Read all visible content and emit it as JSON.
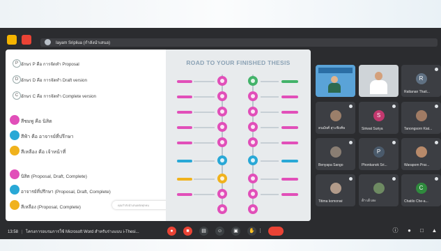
{
  "topbar": {
    "presenter_label": "Iayam Sripliua (กำลังนำเสนอ)"
  },
  "slide": {
    "rows_top": [
      {
        "badge": "P",
        "text": "อักษร P คือ การจัดทำ Proposal"
      },
      {
        "badge": "D",
        "text": "อักษร D คือ การจัดทำ Draft version"
      },
      {
        "badge": "C",
        "text": "อักษร C คือ การจัดทำ Complete version"
      }
    ],
    "rows_middle": [
      {
        "color": "#e14fb9",
        "text": "สีชมพู คือ นิสิต"
      },
      {
        "color": "#29a8d6",
        "text": "สีฟ้า คือ อาจารย์ที่ปรึกษา"
      },
      {
        "color": "#f0b21d",
        "text": "สีเหลือง คือ เจ้าหน้าที่"
      }
    ],
    "rows_bottom": [
      {
        "color": "#e14fb9",
        "text": "นิสิต (Proposal, Draft, Complete)"
      },
      {
        "color": "#29a8d6",
        "text": "อาจารย์ที่ปรึกษา (Proposal, Draft, Complete)"
      },
      {
        "color": "#f0b21d",
        "text": "สีเหลือง (Proposal, Complete)"
      }
    ],
    "banner": {
      "text": "คุณกำลังนำเสนอต่อทุกคน",
      "button": "Stop sharing"
    },
    "infographic_title": "ROAD TO YOUR FINISHED THESIS",
    "colors": {
      "pink": "#e14fb9",
      "blue": "#29a8d6",
      "yellow": "#f0b21d",
      "green": "#43b36a"
    }
  },
  "participants": [
    {
      "name": "",
      "kind": "video",
      "bg": "#5aa3d8"
    },
    {
      "name": "",
      "kind": "video",
      "bg": "#cfd4d8"
    },
    {
      "name": "Rattanan Thait...",
      "kind": "avatar",
      "initial": "R",
      "color": "#5f7082"
    },
    {
      "name": "ดนมัยศ์ สุวะพิงศ์ษ",
      "kind": "photo",
      "initial": "",
      "color": "#9b7f6a"
    },
    {
      "name": "Siriwat Suriya",
      "kind": "avatar",
      "initial": "S",
      "color": "#c2386e"
    },
    {
      "name": "Tanongsorn Kiat...",
      "kind": "photo",
      "initial": "",
      "color": "#a07b64"
    },
    {
      "name": "Benyapa Sango",
      "kind": "photo",
      "initial": "",
      "color": "#8a7e73"
    },
    {
      "name": "Phonkanok Sri...",
      "kind": "avatar",
      "initial": "P",
      "color": "#4a5a6b"
    },
    {
      "name": "Warapom Prar...",
      "kind": "photo",
      "initial": "",
      "color": "#b88a6a"
    },
    {
      "name": "Titima komonwi",
      "kind": "photo",
      "initial": "",
      "color": "#b29b8a"
    },
    {
      "name": "อ้า เอ้ เอะ",
      "kind": "photo",
      "initial": "",
      "color": "#6e8a62"
    },
    {
      "name": "Chatilo Che-a...",
      "kind": "avatar",
      "initial": "C",
      "color": "#2f8a3d"
    }
  ],
  "bottombar": {
    "time": "13:58",
    "meeting_title": "โครงการอบรมการใช้ Microsoft Word สำหรับร่างแบบ i-Thesi..."
  }
}
